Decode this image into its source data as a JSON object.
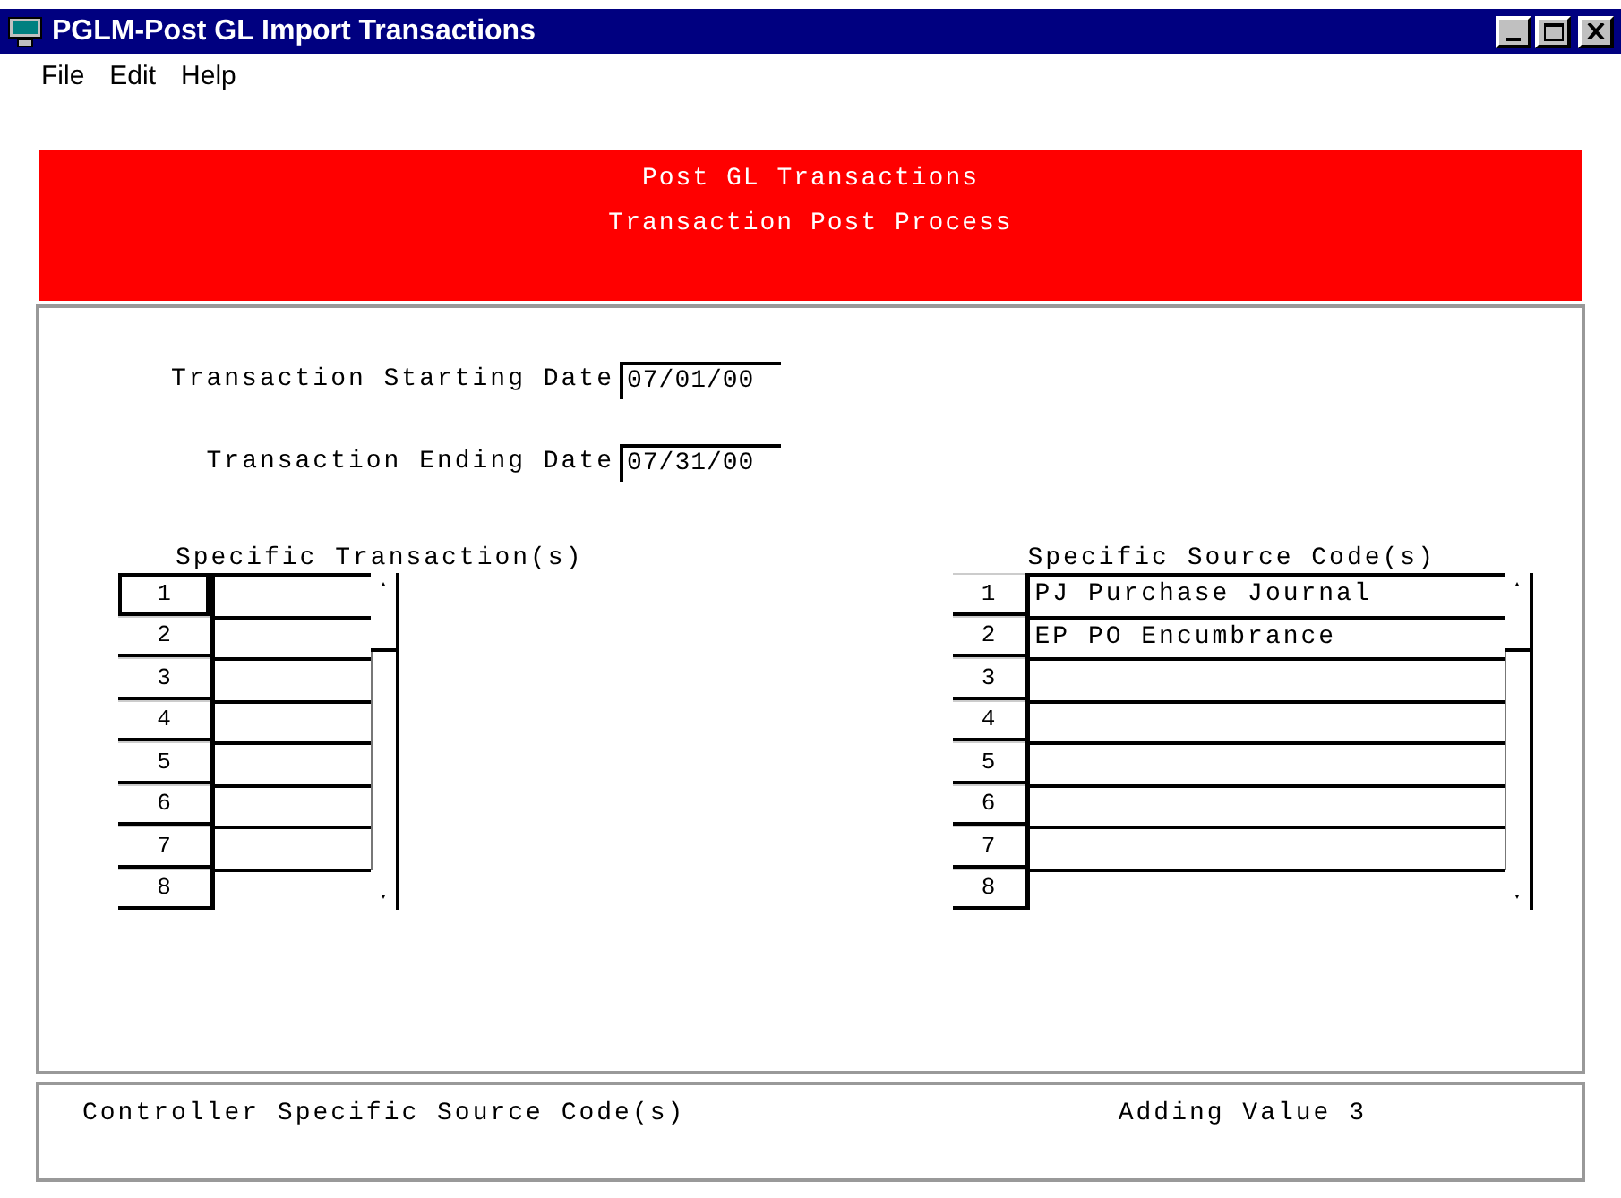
{
  "window": {
    "title": "PGLM-Post GL Import Transactions"
  },
  "menu": [
    "File",
    "Edit",
    "Help"
  ],
  "header": {
    "lines": [
      "Post GL Transactions",
      "Transaction Post Process"
    ]
  },
  "dates": [
    {
      "label": "Transaction Starting Date",
      "value": "07/01/00"
    },
    {
      "label": "Transaction Ending Date",
      "value": "07/31/00"
    }
  ],
  "lists": [
    {
      "title": "Specific Transaction(s)",
      "rows": [
        {
          "number": "1",
          "value": "",
          "selected": true
        },
        {
          "number": "2",
          "value": "",
          "selected": false
        },
        {
          "number": "3",
          "value": "",
          "selected": false
        },
        {
          "number": "4",
          "value": "",
          "selected": false
        },
        {
          "number": "5",
          "value": "",
          "selected": false
        },
        {
          "number": "6",
          "value": "",
          "selected": false
        },
        {
          "number": "7",
          "value": "",
          "selected": false
        },
        {
          "number": "8",
          "value": "",
          "selected": false
        }
      ]
    },
    {
      "title": "Specific Source Code(s)",
      "rows": [
        {
          "number": "1",
          "value": "PJ Purchase Journal",
          "selected": false
        },
        {
          "number": "2",
          "value": "EP PO Encumbrance",
          "selected": false
        },
        {
          "number": "3",
          "value": "",
          "selected": false
        },
        {
          "number": "4",
          "value": "",
          "selected": false
        },
        {
          "number": "5",
          "value": "",
          "selected": false
        },
        {
          "number": "6",
          "value": "",
          "selected": false
        },
        {
          "number": "7",
          "value": "",
          "selected": false
        },
        {
          "number": "8",
          "value": "",
          "selected": false
        }
      ]
    }
  ],
  "status_bar": {
    "left": "Controller Specific Source Code(s)",
    "right": "Adding Value 3"
  }
}
